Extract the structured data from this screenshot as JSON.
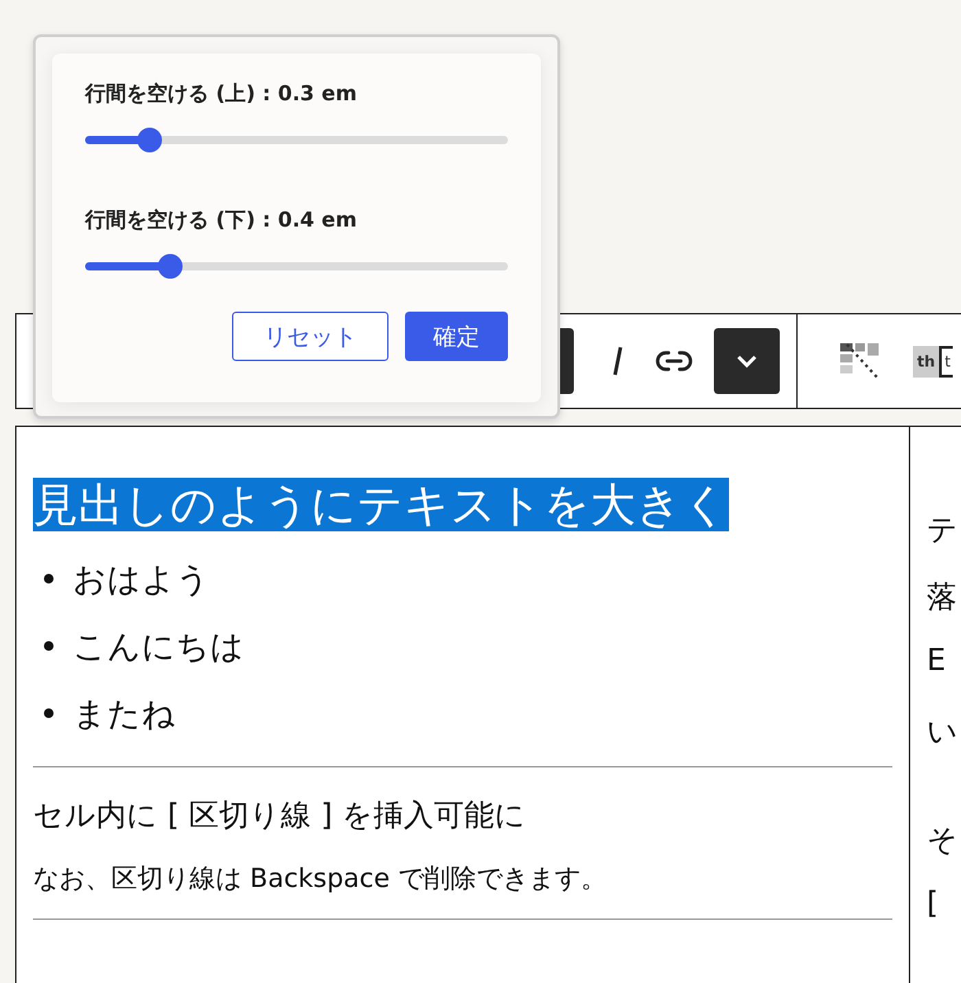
{
  "toolbar": {
    "items": [
      {
        "kind": "dark-edge"
      },
      {
        "kind": "italic"
      },
      {
        "kind": "link"
      },
      {
        "kind": "chevron"
      },
      {
        "kind": "divider"
      },
      {
        "kind": "merge"
      },
      {
        "kind": "th",
        "label": "th",
        "cut_label": "t"
      }
    ]
  },
  "editor": {
    "cells": [
      {
        "blocks": [
          {
            "kind": "heading",
            "text": "見出しのようにテキストを大きく",
            "highlighted": true
          },
          {
            "kind": "list",
            "items": [
              "おはよう",
              "こんにちは",
              "またね"
            ]
          },
          {
            "kind": "rule"
          },
          {
            "kind": "large",
            "text": "セル内に [ 区切り線 ] を挿入可能に"
          },
          {
            "kind": "normal",
            "text": "なお、区切り線は Backspace で削除できます。"
          },
          {
            "kind": "rule"
          }
        ]
      },
      {
        "blocks": [
          {
            "kind": "lines",
            "lines": [
              "テ",
              "落",
              "E",
              "い"
            ]
          },
          {
            "kind": "lines",
            "lines": [
              "そ",
              "["
            ]
          }
        ]
      }
    ]
  },
  "popover": {
    "sliders": [
      {
        "label": "行間を空ける (上) : 0.3 em",
        "level": 0.154
      },
      {
        "label": "行間を空ける (下) : 0.4 em",
        "level": 0.2
      }
    ],
    "buttons": [
      {
        "label": "リセット",
        "kind": "secondary"
      },
      {
        "label": "確定",
        "kind": "primary"
      }
    ]
  }
}
